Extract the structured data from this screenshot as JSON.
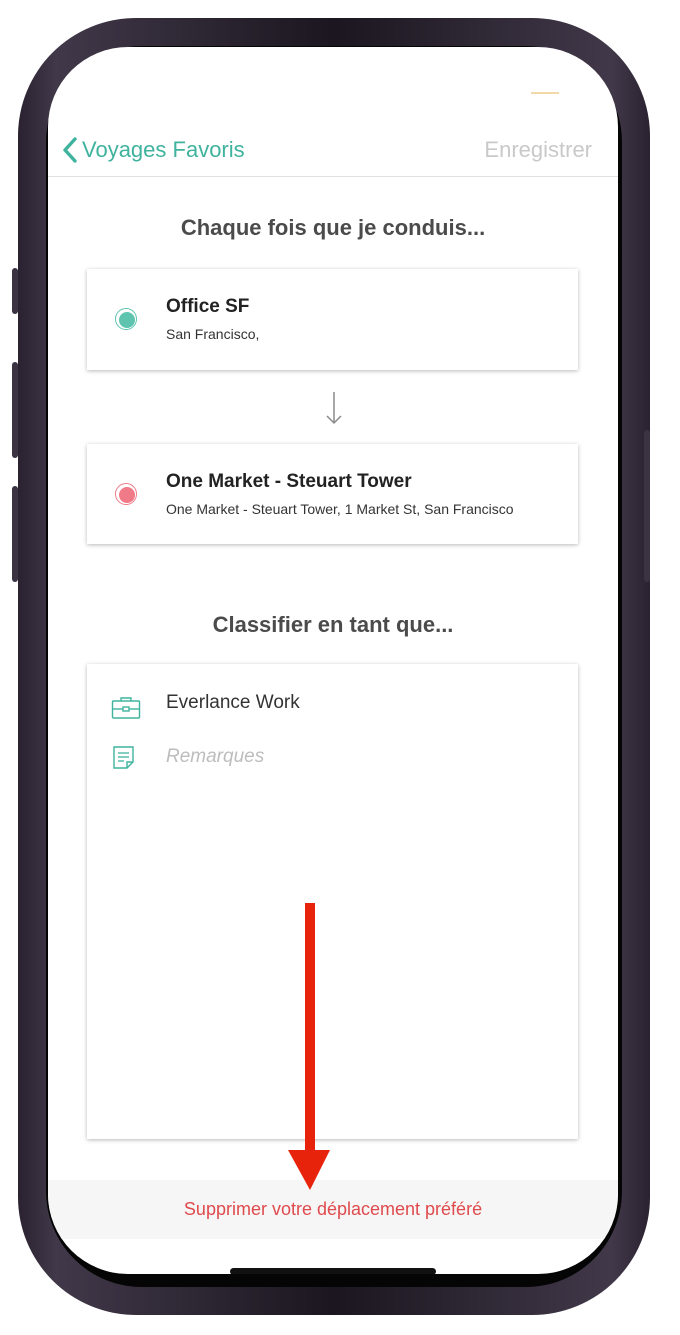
{
  "nav": {
    "back_label": "Voyages Favoris",
    "save_label": "Enregistrer"
  },
  "trip": {
    "heading": "Chaque fois que je conduis...",
    "origin": {
      "title": "Office SF",
      "subtitle": "San Francisco,",
      "color": "#5ec4b0"
    },
    "destination": {
      "title": "One Market - Steuart Tower",
      "subtitle": "One Market - Steuart Tower, 1 Market St, San Francisco",
      "color": "#f07a88"
    }
  },
  "classify": {
    "heading": "Classifier en tant que...",
    "category_label": "Everlance Work",
    "notes_placeholder": "Remarques"
  },
  "delete_label": "Supprimer votre déplacement préféré",
  "colors": {
    "accent": "#3fb39e",
    "danger": "#e04a4d",
    "annotation_arrow": "#e8230c"
  },
  "icons": {
    "back": "chevron-left-icon",
    "down": "arrow-down-icon",
    "category": "briefcase-icon",
    "notes": "note-icon"
  }
}
